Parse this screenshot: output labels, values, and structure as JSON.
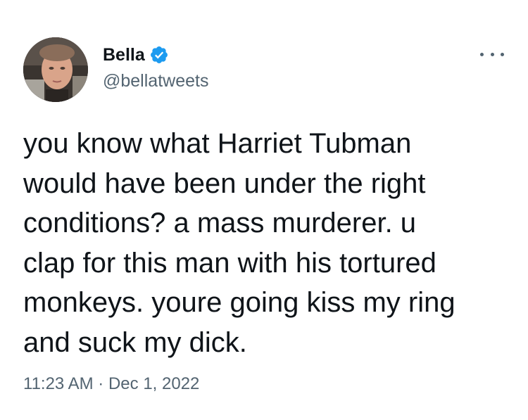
{
  "tweet": {
    "author": {
      "display_name": "Bella",
      "handle": "@bellatweets",
      "verified": true,
      "avatar_icon": "profile-photo"
    },
    "more_icon": "more-horizontal-icon",
    "text": "you know what Harriet Tubman\nwould have been under the right\nconditions? a mass murderer. u\nclap for this man with his tortured\nmonkeys. youre going kiss my ring\nand suck my dick.",
    "time": "11:23 AM",
    "separator": "·",
    "date": "Dec 1, 2022"
  },
  "colors": {
    "text_primary": "#0f1419",
    "text_secondary": "#536471",
    "verified_blue": "#1d9bf0",
    "background": "#ffffff"
  }
}
